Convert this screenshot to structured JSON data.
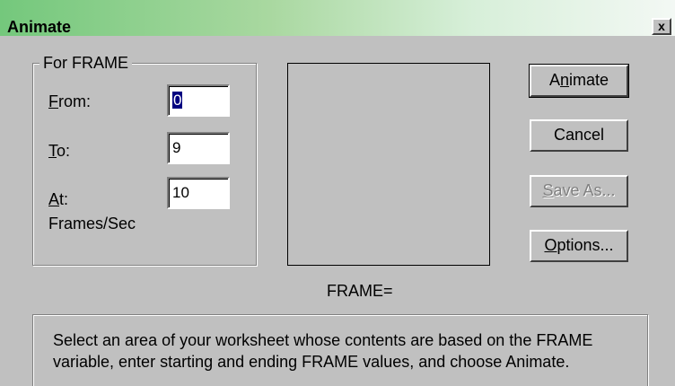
{
  "window": {
    "title": "Animate",
    "close_label": "x"
  },
  "group": {
    "label": "For FRAME",
    "from": {
      "mnemonic": "F",
      "rest": "rom:",
      "value": "0"
    },
    "to": {
      "mnemonic": "T",
      "rest": "o:",
      "value": "9"
    },
    "at": {
      "mnemonic": "A",
      "rest": "t:",
      "value": "10"
    },
    "rate_unit": "Frames/Sec"
  },
  "preview": {
    "caption": "FRAME="
  },
  "buttons": {
    "animate": {
      "pre": "A",
      "mnemonic": "n",
      "post": "imate"
    },
    "cancel": "Cancel",
    "save_as": {
      "mnemonic": "S",
      "rest": "ave As..."
    },
    "options": {
      "mnemonic": "O",
      "rest": "ptions..."
    }
  },
  "info_text": "Select an area of your worksheet whose contents are based on the FRAME variable, enter starting and ending FRAME values, and choose Animate."
}
